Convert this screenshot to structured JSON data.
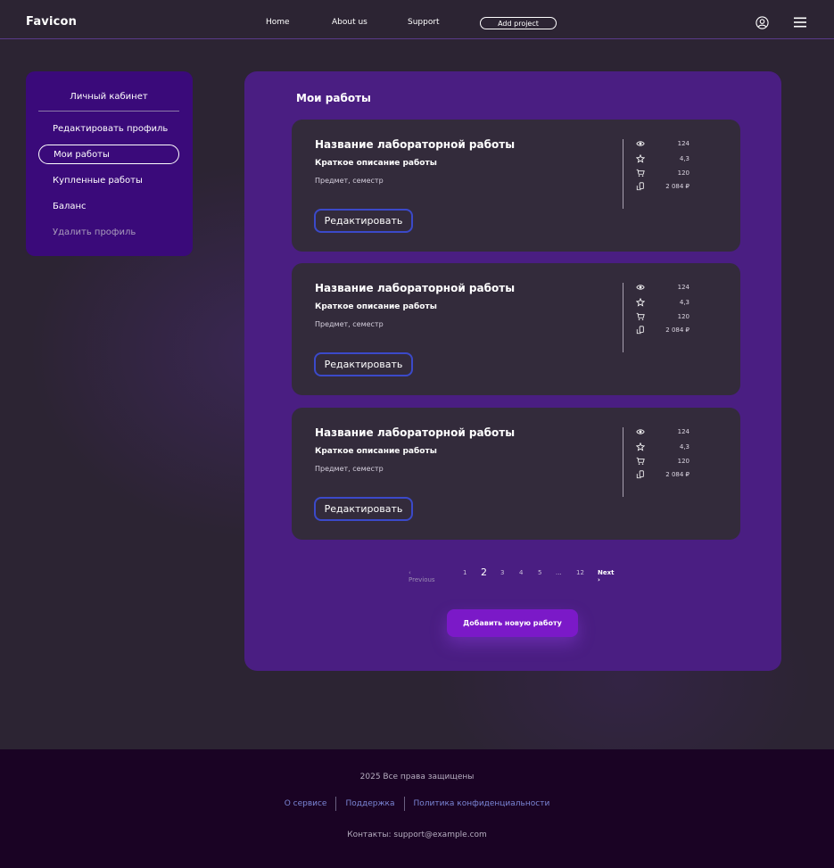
{
  "header": {
    "logo": "Favicon",
    "nav": [
      "Home",
      "About us",
      "Support"
    ],
    "add_project": "Add project",
    "user_icon": "user-circle-icon",
    "menu_icon": "hamburger-menu-icon"
  },
  "sidebar": {
    "title": "Личный кабинет",
    "items": [
      {
        "label": "Редактировать профиль"
      },
      {
        "label": "Мои работы"
      },
      {
        "label": "Купленные работы"
      },
      {
        "label": "Баланс"
      },
      {
        "label": "Удалить профиль"
      }
    ]
  },
  "main": {
    "title": "Мои работы",
    "cards": [
      {
        "title": "Название лабораторной работы",
        "description": "Краткое описание работы",
        "subject": "Предмет, семестр",
        "edit_label": "Редактировать",
        "views": "124",
        "rating": "4,3",
        "purchases": "120",
        "revenue": "2 084 ₽"
      },
      {
        "title": "Название лабораторной работы",
        "description": "Краткое описание работы",
        "subject": "Предмет, семестр",
        "edit_label": "Редактировать",
        "views": "124",
        "rating": "4,3",
        "purchases": "120",
        "revenue": "2 084 ₽"
      },
      {
        "title": "Название лабораторной работы",
        "description": "Краткое описание работы",
        "subject": "Предмет, семестр",
        "edit_label": "Редактировать",
        "views": "124",
        "rating": "4,3",
        "purchases": "120",
        "revenue": "2 084 ₽"
      }
    ],
    "pagination": {
      "previous": "Previous",
      "pages": [
        "1",
        "2",
        "3",
        "4",
        "5",
        "...",
        "12"
      ],
      "current": "2",
      "next": "Next"
    },
    "add_work": "Добавить новую работу"
  },
  "footer": {
    "copyright": "2025 Все права защищены",
    "links": [
      "О сервисе",
      "Поддержка",
      "Политика конфиденциальности"
    ],
    "contacts": "Контакты: support@example.com"
  },
  "colors": {
    "background": "#2c2433",
    "sidebar": "#3a0a7a",
    "panel": "#4a1e82",
    "card": "#332b3b",
    "edit_border": "#3b49c9",
    "accent_button": "#7b19c8",
    "footer": "#1a0324",
    "footer_link": "#7b86d6"
  }
}
